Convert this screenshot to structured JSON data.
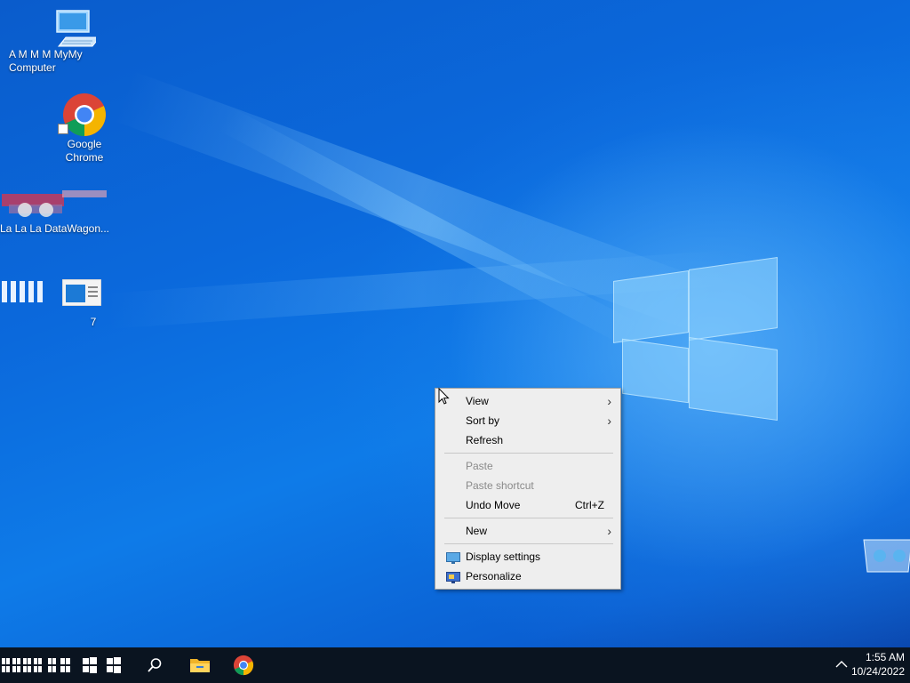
{
  "desktop": {
    "icons": [
      {
        "label": "My Computer",
        "label_prefix": "A  M M M My",
        "icon": "computer-icon"
      },
      {
        "label_line1": "Google",
        "label_line2": "Chrome",
        "icon": "chrome-icon"
      },
      {
        "label": "DataWagon...",
        "label_prefix": "La La La",
        "icon": "datawagon-icon"
      },
      {
        "label": "7",
        "icon": "window-app-icon"
      }
    ]
  },
  "context_menu": {
    "items": [
      {
        "label": "View",
        "submenu": true
      },
      {
        "label": "Sort by",
        "submenu": true
      },
      {
        "label": "Refresh"
      },
      {
        "label": "Paste",
        "disabled": true
      },
      {
        "label": "Paste shortcut",
        "disabled": true
      },
      {
        "label": "Undo Move",
        "shortcut": "Ctrl+Z"
      },
      {
        "label": "New",
        "submenu": true
      },
      {
        "label": "Display settings",
        "icon": "monitor-icon"
      },
      {
        "label": "Personalize",
        "icon": "personalize-icon"
      }
    ]
  },
  "taskbar": {
    "clock_time": "1:55 AM",
    "clock_date": "10/24/2022",
    "icons": [
      "start-icon",
      "search-icon",
      "file-explorer-icon",
      "chrome-icon"
    ],
    "tray_icon": "chevron-up-icon"
  },
  "colors": {
    "taskbar": "#0a1420",
    "desktop_accent": "#0b69dc",
    "menu_bg": "#eeeeee"
  }
}
